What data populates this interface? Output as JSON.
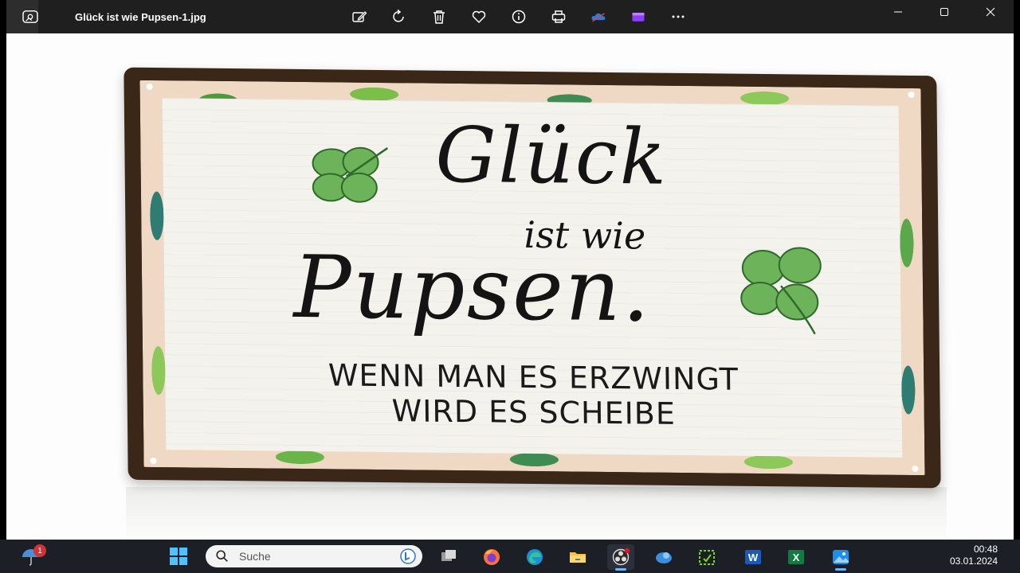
{
  "window": {
    "title": "Glück ist wie Pupsen-1.jpg"
  },
  "toolbar": {
    "buttons": [
      "edit-image-icon",
      "rotate-icon",
      "delete-icon",
      "favorite-icon",
      "info-icon",
      "print-icon",
      "onedrive-icon",
      "clipchamp-icon",
      "more-icon"
    ]
  },
  "image": {
    "line_glueck": "Glück",
    "line_ist_wie": "ist wie",
    "line_pupsen": "Pupsen.",
    "line_sub1": "WENN MAN ES ERZWINGT",
    "line_sub2": "WIRD ES SCHEIBE"
  },
  "taskbar": {
    "weather_badge": "1",
    "search_placeholder": "Suche",
    "apps": [
      "task-view-icon",
      "firefox-icon",
      "edge-icon",
      "file-explorer-icon",
      "obs-icon",
      "app-blue-icon",
      "clipboard-icon",
      "word-icon",
      "excel-icon",
      "photos-icon"
    ],
    "time": "00:48",
    "date": "03.01.2024"
  }
}
